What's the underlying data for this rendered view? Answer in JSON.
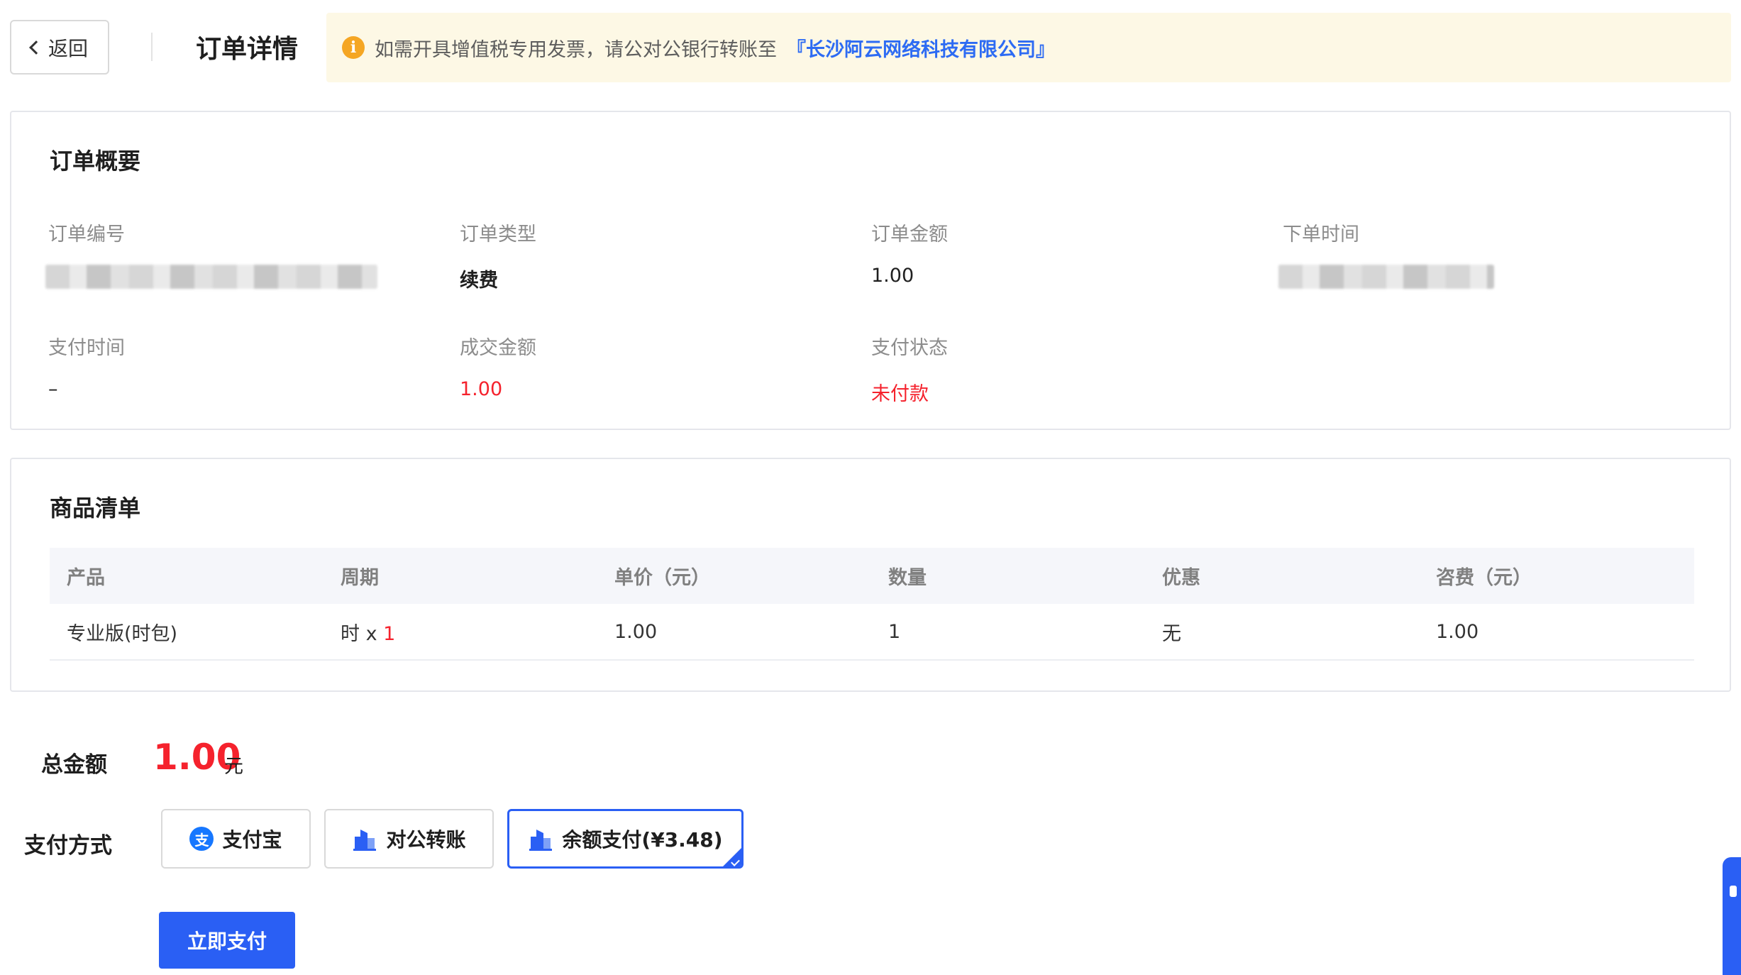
{
  "header": {
    "back_label": "返回",
    "title": "订单详情",
    "notice_text": "如需开具增值税专用发票，请公对公银行转账至",
    "notice_company": "『长沙阿云网络科技有限公司』",
    "notice_icon": "info-icon"
  },
  "summary": {
    "title": "订单概要",
    "fields": [
      {
        "label": "订单编号",
        "value": ""
      },
      {
        "label": "订单类型",
        "value": "续费"
      },
      {
        "label": "订单金额",
        "value": "1.00"
      },
      {
        "label": "下单时间",
        "value": ""
      },
      {
        "label": "支付时间",
        "value": "–"
      },
      {
        "label": "成交金额",
        "value": "1.00"
      },
      {
        "label": "支付状态",
        "value": "未付款"
      }
    ]
  },
  "products": {
    "title": "商品清单",
    "columns": [
      "产品",
      "周期",
      "单价（元）",
      "数量",
      "优惠",
      "咨费（元）"
    ],
    "rows": [
      {
        "product": "专业版(时包)",
        "period_unit": "时 x",
        "period_count": "1",
        "unit_price": "1.00",
        "quantity": "1",
        "discount": "无",
        "fee": "1.00"
      }
    ]
  },
  "totals": {
    "label": "总金额",
    "amount": "1.00",
    "unit": "元"
  },
  "payment": {
    "label": "支付方式",
    "options": [
      {
        "label": "支付宝",
        "icon": "alipay-icon",
        "selected": false
      },
      {
        "label": "对公转账",
        "icon": "bank-icon",
        "selected": false
      },
      {
        "label": "余额支付(¥3.48)",
        "icon": "bank-icon",
        "selected": true
      }
    ],
    "pay_button": "立即支付"
  },
  "colors": {
    "accent": "#2a5ff4",
    "danger": "#f5222d",
    "notice_bg": "#fdf8e5",
    "link": "#2d6bf3"
  }
}
